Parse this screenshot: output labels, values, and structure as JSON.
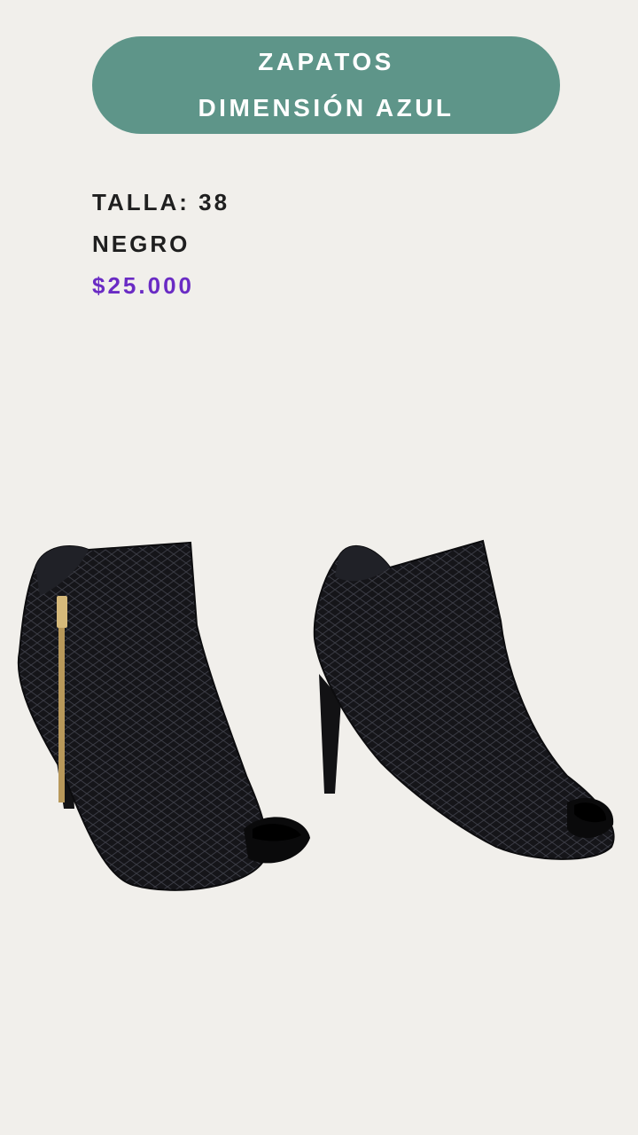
{
  "banner": {
    "line1": "ZAPATOS",
    "line2": "DIMENSIÓN AZUL"
  },
  "product": {
    "size": "TALLA: 38",
    "color": "NEGRO",
    "price": "$25.000"
  },
  "colors": {
    "background": "#f1efeb",
    "banner": "#5e9589",
    "price": "#6a2bc4"
  },
  "image": {
    "icon": "black-peep-toe-ankle-boots-icon"
  }
}
